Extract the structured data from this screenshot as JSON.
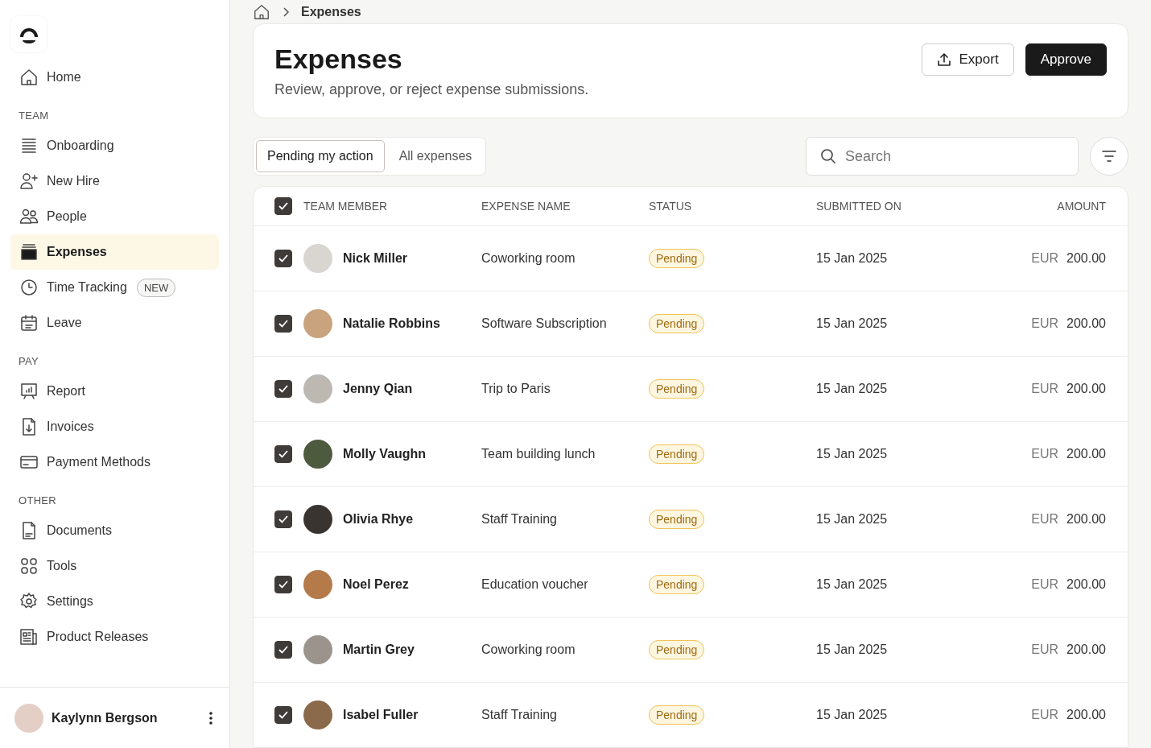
{
  "sidebar": {
    "sections": [
      {
        "items": [
          {
            "label": "Home",
            "kind": "home",
            "selected": false
          }
        ]
      },
      {
        "label": "TEAM",
        "items": [
          {
            "label": "Onboarding",
            "kind": "list",
            "selected": false
          },
          {
            "label": "New Hire",
            "kind": "user-plus",
            "selected": false
          },
          {
            "label": "People",
            "kind": "users",
            "selected": false
          },
          {
            "label": "Expenses",
            "kind": "wallet",
            "selected": true
          },
          {
            "label": "Time Tracking",
            "kind": "clock",
            "selected": false,
            "badge": "NEW"
          },
          {
            "label": "Leave",
            "kind": "calendar",
            "selected": false
          }
        ]
      },
      {
        "label": "PAY",
        "items": [
          {
            "label": "Report",
            "kind": "chart",
            "selected": false
          },
          {
            "label": "Invoices",
            "kind": "invoice",
            "selected": false
          },
          {
            "label": "Payment Methods",
            "kind": "card",
            "selected": false
          }
        ]
      },
      {
        "label": "OTHER",
        "items": [
          {
            "label": "Documents",
            "kind": "document",
            "selected": false
          },
          {
            "label": "Tools",
            "kind": "grid",
            "selected": false
          },
          {
            "label": "Settings",
            "kind": "gear",
            "selected": false
          },
          {
            "label": "Product Releases",
            "kind": "news",
            "selected": false
          }
        ]
      }
    ],
    "user": {
      "name": "Kaylynn Bergson"
    }
  },
  "breadcrumb": {
    "current": "Expenses"
  },
  "header": {
    "title": "Expenses",
    "subtitle": "Review, approve, or reject expense submissions.",
    "buttons": [
      {
        "label": "Export",
        "kind": "secondary"
      },
      {
        "label": "Approve",
        "kind": "primary"
      }
    ]
  },
  "tabs": [
    {
      "label": "Pending my action",
      "selected": true
    },
    {
      "label": "All expenses",
      "selected": false
    }
  ],
  "search": {
    "placeholder": "Search"
  },
  "table": {
    "all_checked": true,
    "columns": [
      "TEAM MEMBER",
      "EXPENSE NAME",
      "STATUS",
      "SUBMITTED ON",
      "AMOUNT"
    ],
    "rows": [
      {
        "checked": true,
        "member": "Nick Miller",
        "expense": "Coworking room",
        "status": "Pending",
        "submitted": "15 Jan 2025",
        "currency": "EUR",
        "amount": "200.00"
      },
      {
        "checked": true,
        "member": "Natalie Robbins",
        "expense": "Software Subscription",
        "status": "Pending",
        "submitted": "15 Jan 2025",
        "currency": "EUR",
        "amount": "200.00"
      },
      {
        "checked": true,
        "member": "Jenny Qian",
        "expense": "Trip to Paris",
        "status": "Pending",
        "submitted": "15 Jan 2025",
        "currency": "EUR",
        "amount": "200.00"
      },
      {
        "checked": true,
        "member": "Molly Vaughn",
        "expense": "Team building lunch",
        "status": "Pending",
        "submitted": "15 Jan 2025",
        "currency": "EUR",
        "amount": "200.00"
      },
      {
        "checked": true,
        "member": "Olivia Rhye",
        "expense": "Staff Training",
        "status": "Pending",
        "submitted": "15 Jan 2025",
        "currency": "EUR",
        "amount": "200.00"
      },
      {
        "checked": true,
        "member": "Noel Perez",
        "expense": "Education voucher",
        "status": "Pending",
        "submitted": "15 Jan 2025",
        "currency": "EUR",
        "amount": "200.00"
      },
      {
        "checked": true,
        "member": "Martin Grey",
        "expense": "Coworking room",
        "status": "Pending",
        "submitted": "15 Jan 2025",
        "currency": "EUR",
        "amount": "200.00"
      },
      {
        "checked": true,
        "member": "Isabel Fuller",
        "expense": "Staff Training",
        "status": "Pending",
        "submitted": "15 Jan 2025",
        "currency": "EUR",
        "amount": "200.00"
      }
    ]
  }
}
